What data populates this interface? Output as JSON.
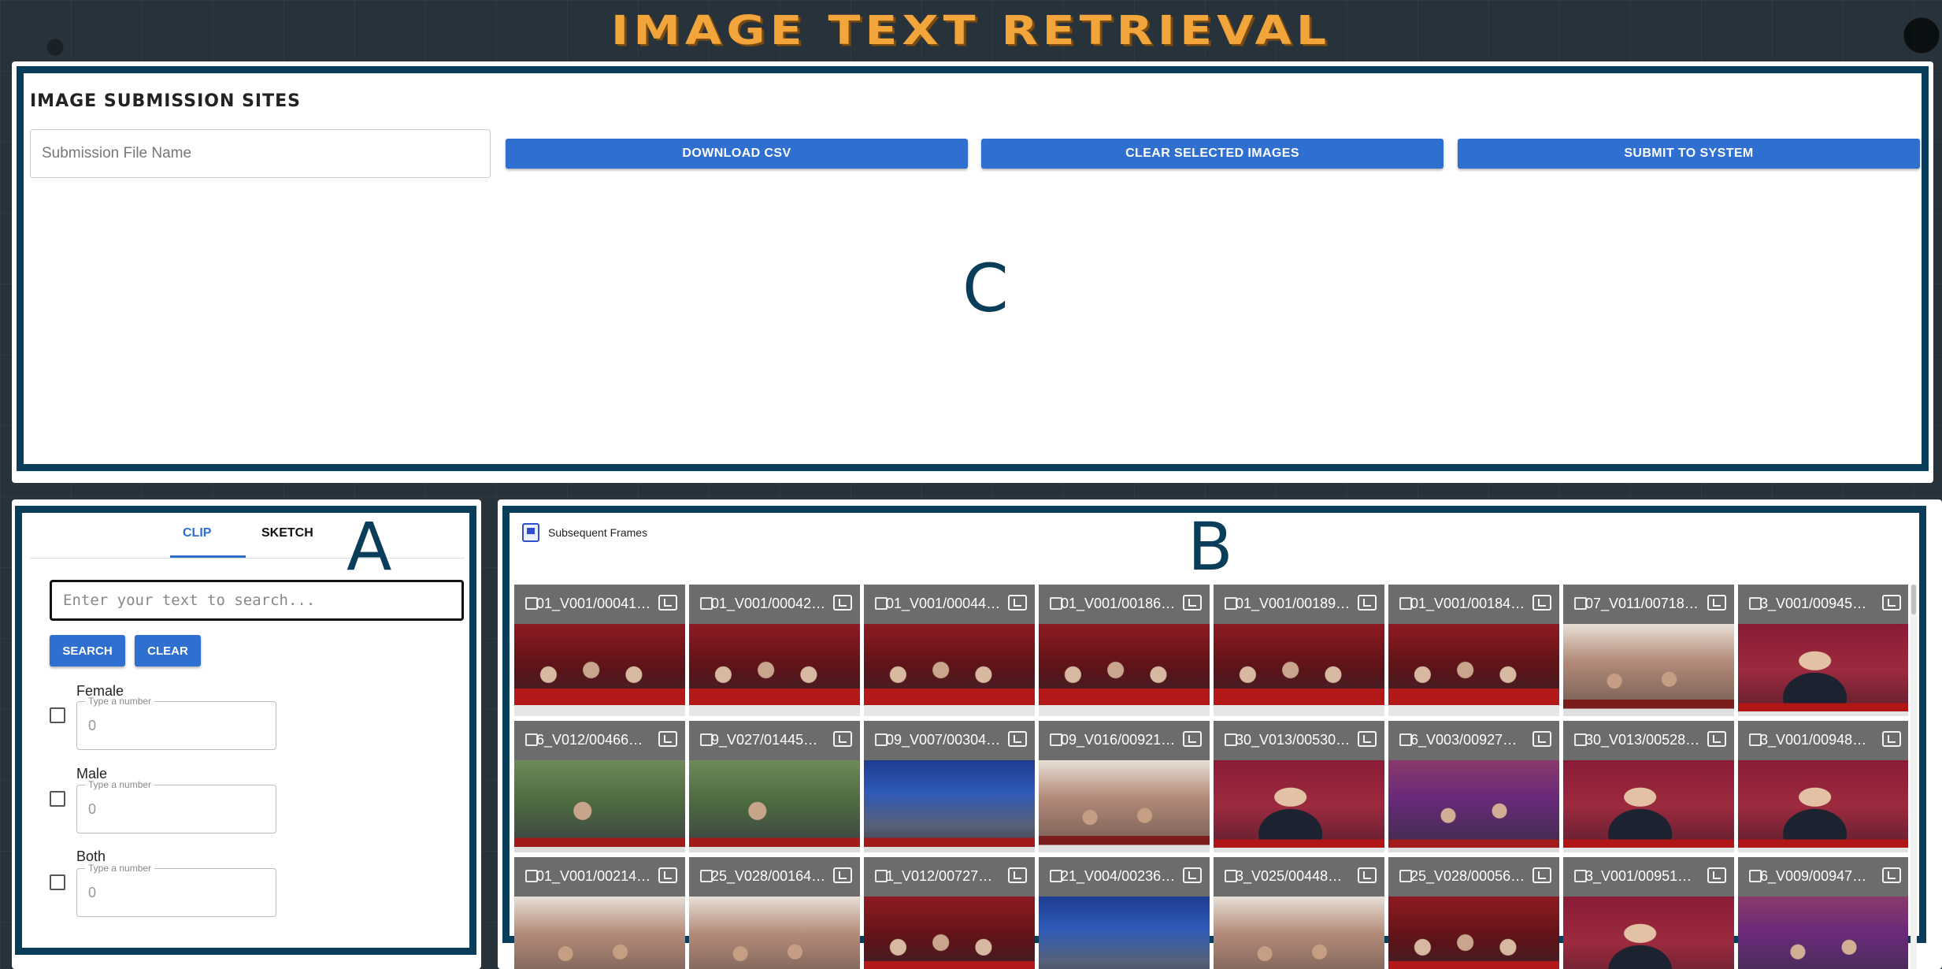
{
  "app": {
    "title": "IMAGE TEXT RETRIEVAL"
  },
  "regions": {
    "c": "C",
    "a": "A",
    "b": "B"
  },
  "submission": {
    "section_title": "IMAGE SUBMISSION SITES",
    "file_name_placeholder": "Submission File Name",
    "download_label": "DOWNLOAD CSV",
    "clear_selected_label": "CLEAR SELECTED IMAGES",
    "submit_label": "SUBMIT TO SYSTEM"
  },
  "search_panel": {
    "tabs": [
      {
        "label": "CLIP",
        "active": true
      },
      {
        "label": "SKETCH",
        "active": false
      }
    ],
    "text_placeholder": "Enter your text to search...",
    "search_label": "SEARCH",
    "clear_label": "CLEAR",
    "filters": [
      {
        "label": "Female",
        "legend": "Type a number",
        "value": "0"
      },
      {
        "label": "Male",
        "legend": "Type a number",
        "value": "0"
      },
      {
        "label": "Both",
        "legend": "Type a number",
        "value": "0"
      }
    ]
  },
  "results_panel": {
    "title": "Subsequent Frames",
    "frames": [
      {
        "label": "01_V001/00041…",
        "thumb": "red"
      },
      {
        "label": "01_V001/00042…",
        "thumb": "red"
      },
      {
        "label": "01_V001/00044…",
        "thumb": "red"
      },
      {
        "label": "01_V001/00186…",
        "thumb": "red"
      },
      {
        "label": "01_V001/00189…",
        "thumb": "red"
      },
      {
        "label": "01_V001/00184…",
        "thumb": "red"
      },
      {
        "label": "07_V011/00718…",
        "thumb": "hall"
      },
      {
        "label": "3_V001/00945…",
        "thumb": "portrait"
      },
      {
        "label": "6_V012/00466…",
        "thumb": "outdoor"
      },
      {
        "label": "9_V027/01445…",
        "thumb": "outdoor"
      },
      {
        "label": "09_V007/00304…",
        "thumb": "blue"
      },
      {
        "label": "09_V016/00921…",
        "thumb": "hall"
      },
      {
        "label": "30_V013/00530…",
        "thumb": "portrait"
      },
      {
        "label": "6_V003/00927…",
        "thumb": "purple"
      },
      {
        "label": "30_V013/00528…",
        "thumb": "portrait"
      },
      {
        "label": "3_V001/00948…",
        "thumb": "portrait"
      },
      {
        "label": "01_V001/00214…",
        "thumb": "hall"
      },
      {
        "label": "25_V028/00164…",
        "thumb": "hall"
      },
      {
        "label": "1_V012/00727…",
        "thumb": "red"
      },
      {
        "label": "21_V004/00236…",
        "thumb": "blue"
      },
      {
        "label": "3_V025/00448…",
        "thumb": "hall"
      },
      {
        "label": "25_V028/00056…",
        "thumb": "red"
      },
      {
        "label": "3_V001/00951…",
        "thumb": "portrait"
      },
      {
        "label": "6_V009/00947…",
        "thumb": "purple"
      }
    ]
  },
  "colors": {
    "accent": "#2f6fcf",
    "outline": "#0a3d5a",
    "title": "#f2a53a",
    "background": "#27323a"
  }
}
